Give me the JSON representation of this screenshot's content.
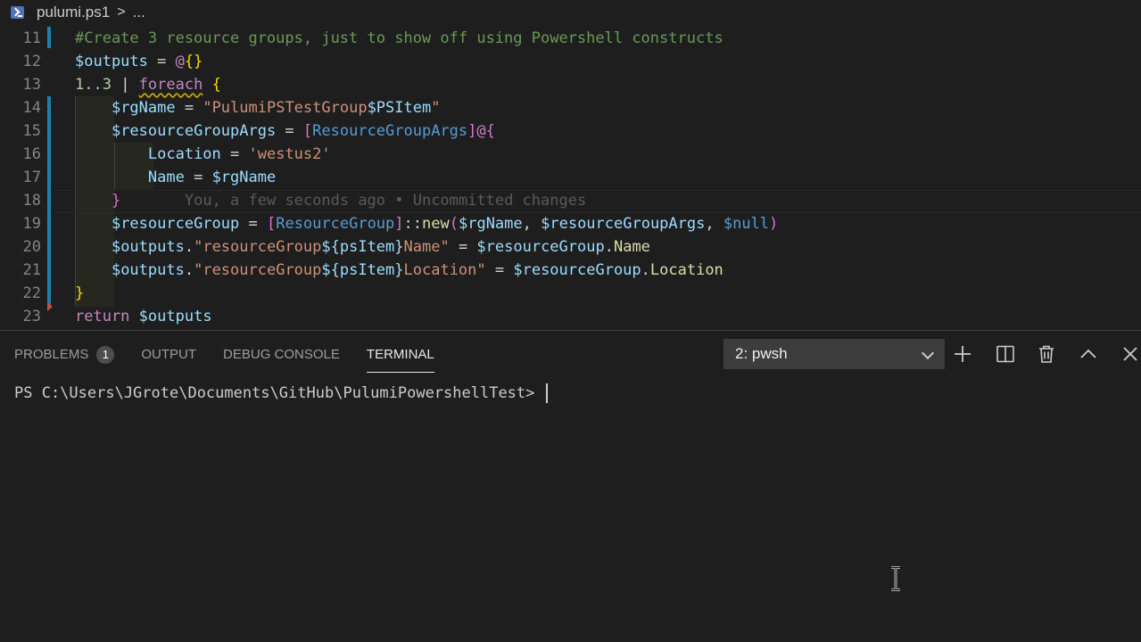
{
  "breadcrumb": {
    "file": "pulumi.ps1",
    "more": "...",
    "separator": ">"
  },
  "editor": {
    "lines": [
      {
        "n": "11",
        "tokens": [
          [
            "#Create 3 resource groups, just to show off using Powershell constructs",
            "c-comment"
          ]
        ]
      },
      {
        "n": "12",
        "tokens": [
          [
            "$outputs",
            "c-var"
          ],
          [
            " = ",
            "c-op"
          ],
          [
            "@",
            "c-kw"
          ],
          [
            "{}",
            "c-br1"
          ]
        ]
      },
      {
        "n": "13",
        "tokens": [
          [
            "1..3",
            "c-num"
          ],
          [
            " | ",
            "c-op"
          ],
          [
            "foreach",
            "c-kw squiggle"
          ],
          [
            " ",
            "c-op"
          ],
          [
            "{",
            "c-br1"
          ]
        ]
      },
      {
        "n": "14",
        "tokens": [
          [
            "    ",
            "c-op"
          ],
          [
            "$rgName",
            "c-var"
          ],
          [
            " = ",
            "c-op"
          ],
          [
            "\"PulumiPSTestGroup",
            "c-str"
          ],
          [
            "$PSItem",
            "c-var"
          ],
          [
            "\"",
            "c-str"
          ]
        ]
      },
      {
        "n": "15",
        "tokens": [
          [
            "    ",
            "c-op"
          ],
          [
            "$resourceGroupArgs",
            "c-var"
          ],
          [
            " = ",
            "c-op"
          ],
          [
            "[",
            "c-br2"
          ],
          [
            "ResourceGroupArgs",
            "c-typeb"
          ],
          [
            "]",
            "c-br2"
          ],
          [
            "@",
            "c-kw"
          ],
          [
            "{",
            "c-br2"
          ]
        ]
      },
      {
        "n": "16",
        "tokens": [
          [
            "        ",
            "c-op"
          ],
          [
            "Location",
            "c-var"
          ],
          [
            " = ",
            "c-op"
          ],
          [
            "'westus2'",
            "c-str"
          ]
        ]
      },
      {
        "n": "17",
        "tokens": [
          [
            "        ",
            "c-op"
          ],
          [
            "Name",
            "c-var"
          ],
          [
            " = ",
            "c-op"
          ],
          [
            "$rgName",
            "c-var"
          ]
        ]
      },
      {
        "n": "18",
        "tokens": [
          [
            "    ",
            "c-op"
          ],
          [
            "}",
            "c-br2"
          ],
          [
            "       ",
            "c-op"
          ]
        ],
        "blame": "You, a few seconds ago • Uncommitted changes"
      },
      {
        "n": "19",
        "tokens": [
          [
            "    ",
            "c-op"
          ],
          [
            "$resourceGroup",
            "c-var"
          ],
          [
            " = ",
            "c-op"
          ],
          [
            "[",
            "c-br2"
          ],
          [
            "ResourceGroup",
            "c-typeb"
          ],
          [
            "]",
            "c-br2"
          ],
          [
            "::",
            "c-op"
          ],
          [
            "new",
            "c-fn"
          ],
          [
            "(",
            "c-br2"
          ],
          [
            "$rgName",
            "c-var"
          ],
          [
            ", ",
            "c-op"
          ],
          [
            "$resourceGroupArgs",
            "c-var"
          ],
          [
            ", ",
            "c-op"
          ],
          [
            "$null",
            "c-typeb"
          ],
          [
            ")",
            "c-br2"
          ]
        ]
      },
      {
        "n": "20",
        "tokens": [
          [
            "    ",
            "c-op"
          ],
          [
            "$outputs",
            "c-var"
          ],
          [
            ".",
            "c-op"
          ],
          [
            "\"resourceGroup",
            "c-str"
          ],
          [
            "${psItem}",
            "c-var"
          ],
          [
            "Name\"",
            "c-str"
          ],
          [
            " = ",
            "c-op"
          ],
          [
            "$resourceGroup",
            "c-var"
          ],
          [
            ".",
            "c-op"
          ],
          [
            "Name",
            "c-fn"
          ]
        ]
      },
      {
        "n": "21",
        "tokens": [
          [
            "    ",
            "c-op"
          ],
          [
            "$outputs",
            "c-var"
          ],
          [
            ".",
            "c-op"
          ],
          [
            "\"resourceGroup",
            "c-str"
          ],
          [
            "${psItem}",
            "c-var"
          ],
          [
            "Location\"",
            "c-str"
          ],
          [
            " = ",
            "c-op"
          ],
          [
            "$resourceGroup",
            "c-var"
          ],
          [
            ".",
            "c-op"
          ],
          [
            "Location",
            "c-fn"
          ]
        ]
      },
      {
        "n": "22",
        "tokens": [
          [
            "}",
            "c-br1"
          ]
        ]
      },
      {
        "n": "23",
        "tokens": [
          [
            "return",
            "c-kw"
          ],
          [
            " ",
            "c-op"
          ],
          [
            "$outputs",
            "c-var"
          ]
        ]
      }
    ]
  },
  "panel": {
    "tabs": [
      {
        "label": "PROBLEMS",
        "badge": "1",
        "active": false
      },
      {
        "label": "OUTPUT",
        "active": false
      },
      {
        "label": "DEBUG CONSOLE",
        "active": false
      },
      {
        "label": "TERMINAL",
        "active": true
      }
    ],
    "terminal_select": "2: pwsh",
    "toolbar_icons": [
      "plus-icon",
      "split-icon",
      "trash-icon",
      "chevron-up-icon",
      "close-icon"
    ],
    "prompt": "PS C:\\Users\\JGrote\\Documents\\GitHub\\PulumiPowershellTest> "
  }
}
